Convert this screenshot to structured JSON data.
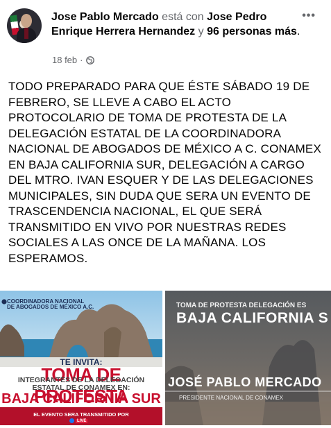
{
  "post": {
    "author": "Jose Pablo Mercado",
    "with_text": "está con",
    "tagged_person": "Jose Pedro Enrique Herrera Hernandez",
    "and_text": "y",
    "others": "96 personas más",
    "period": ".",
    "date": "18 feb",
    "separator": "·",
    "visibility_icon": "globe-icon",
    "more_icon": "more-options-icon",
    "more_glyph": "•••",
    "text": "TODO PREPARADO PARA QUE ÉSTE SÁBADO 19 DE FEBRERO, SE LLEVE A CABO EL ACTO PROTOCOLARIO DE TOMA DE PROTESTA DE LA DELEGACIÓN ESTATAL DE LA COORDINADORA NACIONAL DE ABOGADOS DE MÉXICO A C. CONAMEX EN BAJA CALIFORNIA SUR, DELEGACIÓN A CARGO DEL MTRO. IVAN ESQUER Y DE LAS DELEGACIONES MUNICIPALES, SIN DUDA QUE SERA UN EVENTO DE TRASCENDENCIA NACIONAL, EL QUE SERÁ TRANSMITIDO EN VIVO POR NUESTRAS REDES SOCIALES A LAS ONCE DE LA MAÑANA. LOS ESPERAMOS."
  },
  "image_left": {
    "logo_line1": "COORDINADORA NACIONAL",
    "logo_line2": "DE ABOGADOS DE MÉXICO A.C.",
    "invita": "TE INVITA:",
    "toma": "TOMA DE PROTESTA",
    "integrantes_line1": "INTEGRANTES DE LA DELEGACIÓN",
    "integrantes_line2": "ESTATAL DE CONAMEX EN:",
    "bcs": "BAJA CALIFORNIA SUR",
    "banner": "EL EVENTO SERA TRANSMITIDO POR",
    "live": "LIVE"
  },
  "image_right": {
    "top_title": "TOMA DE PROTESTA DELEGACIÓN ES",
    "big_title": "BAJA CALIFORNIA S",
    "name": "JOSÉ PABLO MERCADO",
    "role": "PRESIDENTE NACIONAL DE CONAMEX"
  }
}
